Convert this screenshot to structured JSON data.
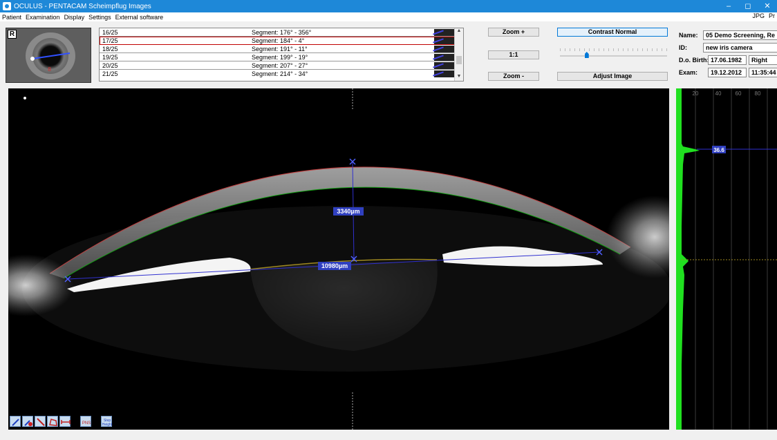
{
  "window": {
    "title": "OCULUS - PENTACAM  Scheimpflug Images",
    "controls": [
      "–",
      "◻",
      "✕"
    ]
  },
  "menu": {
    "items": [
      "Patient",
      "Examination",
      "Display",
      "Settings",
      "External software"
    ],
    "right_items": [
      "JPG",
      "Pr"
    ]
  },
  "thumbnail": {
    "eye_label": "R"
  },
  "segments": [
    {
      "num": "16/25",
      "label": "Segment: 176° - 356°"
    },
    {
      "num": "17/25",
      "label": "Segment: 184° - 4°",
      "selected": true
    },
    {
      "num": "18/25",
      "label": "Segment: 191° - 11°"
    },
    {
      "num": "19/25",
      "label": "Segment: 199° - 19°"
    },
    {
      "num": "20/25",
      "label": "Segment: 207° - 27°"
    },
    {
      "num": "21/25",
      "label": "Segment: 214° - 34°"
    }
  ],
  "zoom": {
    "zoom_in": "Zoom +",
    "one_to_one": "1:1",
    "zoom_out": "Zoom -"
  },
  "contrast": {
    "contrast_label": "Contrast Normal",
    "adjust_label": "Adjust Image",
    "level": 0.24
  },
  "patient": {
    "name_label": "Name:",
    "name": "05 Demo Screening, Re",
    "id_label": "ID:",
    "id": "new iris camera",
    "dob_label": "D.o. Birth:",
    "dob": "17.06.1982",
    "eye": "Right",
    "exam_label": "Exam:",
    "exam_date": "19.12.2012",
    "exam_time": "11:35:44"
  },
  "measurements": {
    "depth": "3340µm",
    "width": "10980µm"
  },
  "density": {
    "ticks": [
      "20",
      "40",
      "60",
      "80"
    ],
    "peak_value": "36.6"
  },
  "colors": {
    "titlebar": "#1e88d8",
    "measure_line": "#3030d0",
    "cornea_inner": "#10a010",
    "cornea_outer": "#c04040",
    "density": "#20e020"
  },
  "tools": [
    "pen-tool-icon",
    "delete-tool-icon",
    "line-tool-icon",
    "polygon-tool-icon",
    "distance-tool-icon",
    "pns-tool-icon",
    "step-height-icon"
  ]
}
